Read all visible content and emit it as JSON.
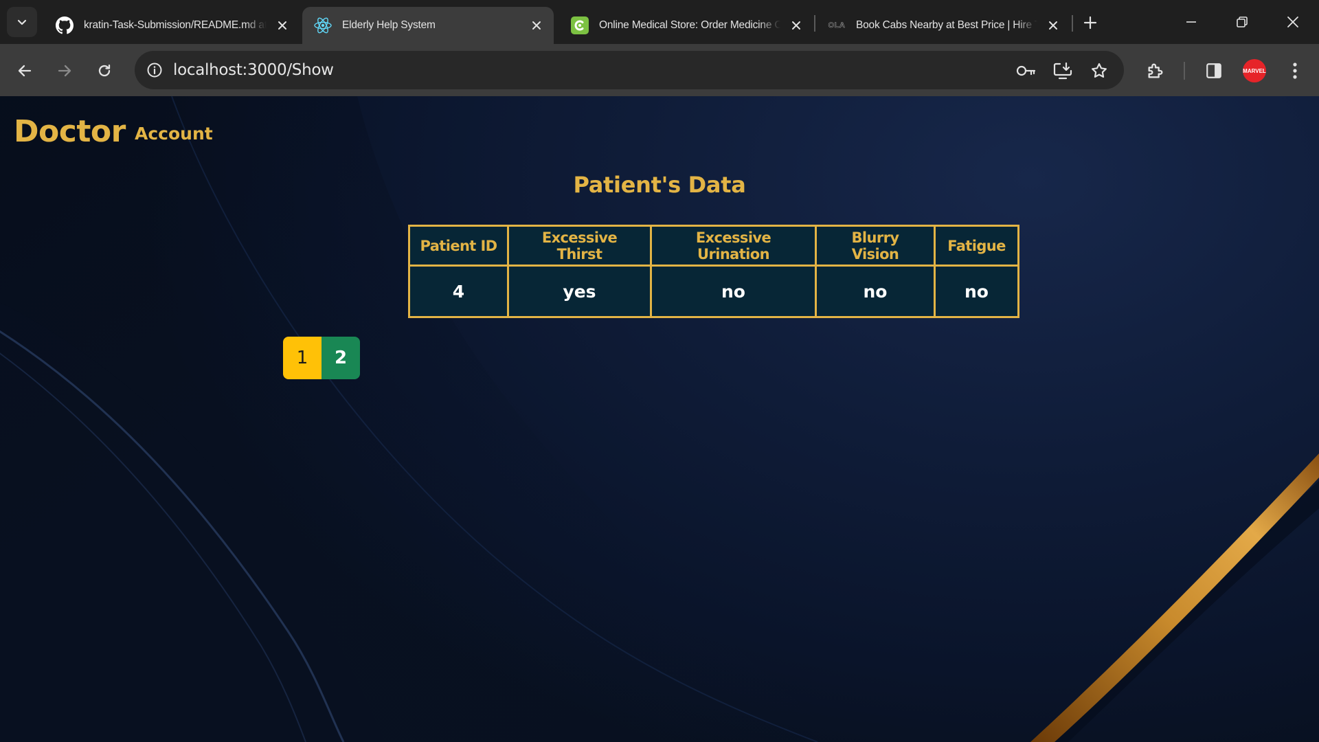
{
  "browser": {
    "tabs": [
      {
        "title": "kratin-Task-Submission/README.md at",
        "favicon": "github-icon",
        "active": false
      },
      {
        "title": "Elderly Help System",
        "favicon": "react-icon",
        "active": true
      },
      {
        "title": "Online Medical Store: Order Medicine Online",
        "favicon": "pharmacy-icon",
        "active": false
      },
      {
        "title": "Book Cabs Nearby at Best Price | Hire Taxi",
        "favicon": "ola-icon",
        "favicon_text": "OLA",
        "active": false
      }
    ],
    "url": "localhost:3000/Show",
    "profile_text": "MARVEL"
  },
  "page": {
    "brand": "Doctor",
    "nav": {
      "account": "Account"
    },
    "heading": "Patient's Data",
    "table": {
      "headers": [
        "Patient ID",
        "Excessive Thirst",
        "Excessive Urination",
        "Blurry Vision",
        "Fatigue"
      ],
      "rows": [
        [
          "4",
          "yes",
          "no",
          "no",
          "no"
        ]
      ]
    },
    "pagination": {
      "pages": [
        "1",
        "2"
      ],
      "current": "1"
    }
  },
  "colors": {
    "accent_gold": "#e3b445",
    "table_cell_bg": "#072636",
    "page_active": "#ffc107",
    "page_other": "#198754"
  }
}
